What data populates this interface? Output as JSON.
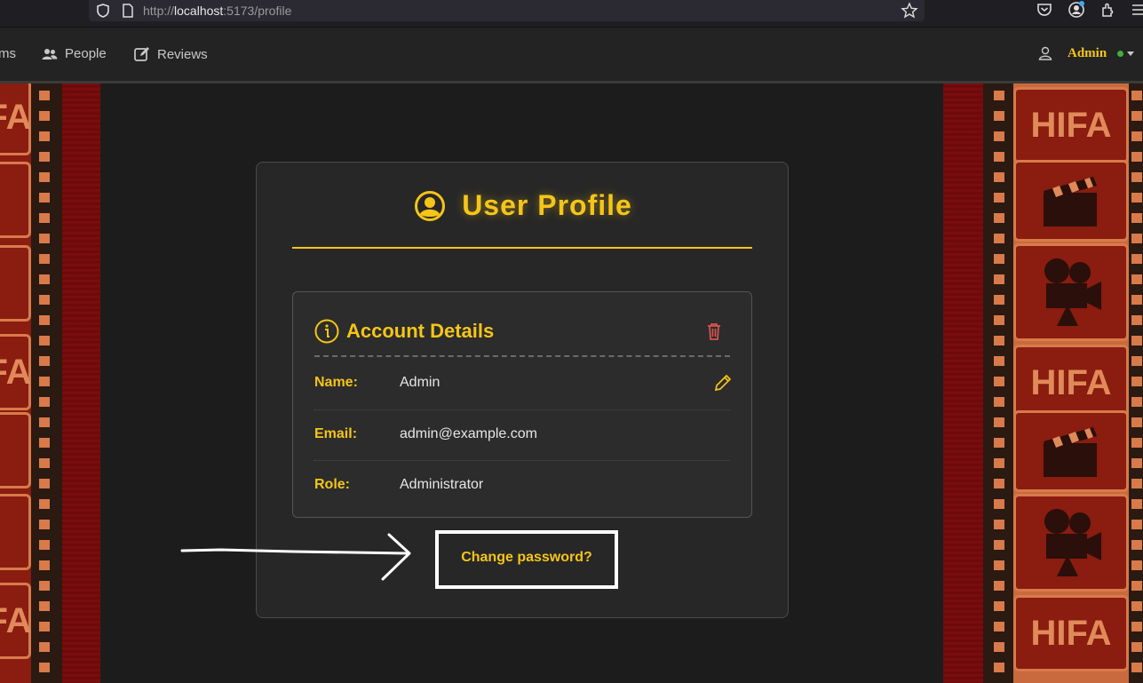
{
  "browser": {
    "url_prefix": "http://",
    "url_host": "localhost",
    "url_rest": ":5173/profile"
  },
  "nav": {
    "items": [
      {
        "label": "ms",
        "icon": "film-icon"
      },
      {
        "label": "People",
        "icon": "people-icon"
      },
      {
        "label": "Reviews",
        "icon": "edit-icon"
      }
    ],
    "user_name": "Admin",
    "status_color": "#3cb043"
  },
  "film_strip": {
    "frame_text": "HIFA",
    "frame_text_partial": "A"
  },
  "profile": {
    "title": "User Profile",
    "section_title": "Account Details",
    "fields": [
      {
        "label": "Name:",
        "value": "Admin"
      },
      {
        "label": "Email:",
        "value": "admin@example.com"
      },
      {
        "label": "Role:",
        "value": "Administrator"
      }
    ],
    "change_password": "Change password?"
  },
  "colors": {
    "accent": "#f5c518",
    "danger": "#d9534f",
    "background": "#1c1c1c",
    "card": "#272727"
  }
}
